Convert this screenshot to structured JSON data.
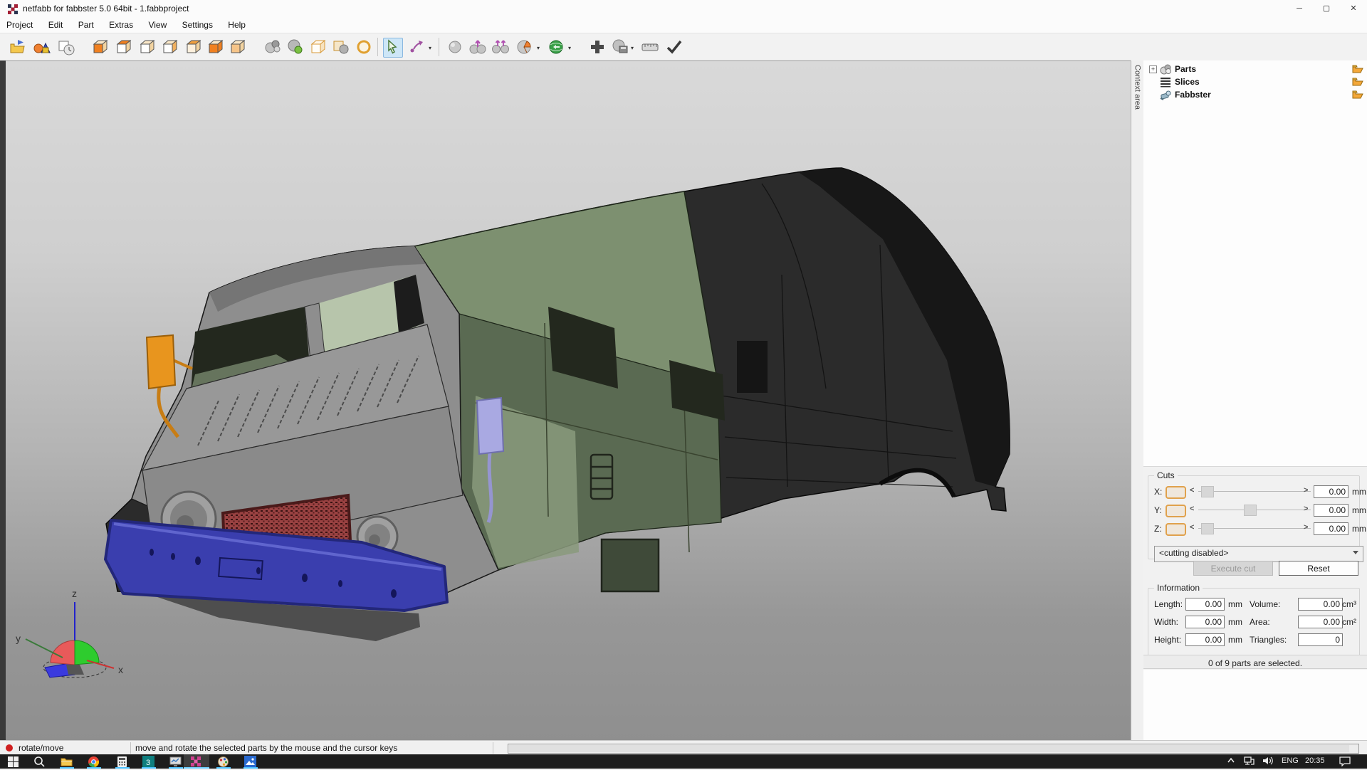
{
  "window": {
    "title": "netfabb for fabbster 5.0 64bit - 1.fabbproject",
    "controls": {
      "minimize": "─",
      "maximize": "▢",
      "close": "✕"
    }
  },
  "menu": {
    "items": [
      "Project",
      "Edit",
      "Part",
      "Extras",
      "View",
      "Settings",
      "Help"
    ]
  },
  "toolbar": {
    "icons": [
      "open-project-icon",
      "add-part-icon",
      "project-info-icon",
      "view-cube-front-icon",
      "view-cube-back-icon",
      "view-cube-left-icon",
      "view-cube-right-icon",
      "view-cube-top-icon",
      "view-cube-bottom-icon",
      "view-cube-iso-icon",
      "repair-part-icon",
      "part-quality-icon",
      "box-frame-icon",
      "cube-sphere-icon",
      "zoom-icon",
      "select-cursor-icon",
      "move-rotate-icon",
      "default-part-icon",
      "move-part-icon",
      "scale-part-icon",
      "analyse-icon",
      "slice-icon",
      "add-icon",
      "export-icon",
      "measure-icon",
      "validate-icon"
    ]
  },
  "viewport": {
    "context_tab": "Context area",
    "axis_labels": {
      "x": "x",
      "y": "y",
      "z": "z"
    }
  },
  "panel": {
    "tree": [
      {
        "label": "Parts"
      },
      {
        "label": "Slices"
      },
      {
        "label": "Fabbster"
      }
    ],
    "expander": "+",
    "cuts": {
      "title": "Cuts",
      "arrow_left": "<",
      "arrow_right": ">",
      "rows": [
        {
          "label": "X:",
          "value": "0.00",
          "unit": "mm"
        },
        {
          "label": "Y:",
          "value": "0.00",
          "unit": "mm"
        },
        {
          "label": "Z:",
          "value": "0.00",
          "unit": "mm"
        }
      ],
      "mode": "<cutting disabled>",
      "execute": "Execute cut",
      "reset": "Reset"
    },
    "info": {
      "title": "Information",
      "left": [
        {
          "label": "Length:",
          "value": "0.00",
          "unit": "mm"
        },
        {
          "label": "Width:",
          "value": "0.00",
          "unit": "mm"
        },
        {
          "label": "Height:",
          "value": "0.00",
          "unit": "mm"
        }
      ],
      "right": [
        {
          "label": "Volume:",
          "value": "0.00",
          "unit": "cm³"
        },
        {
          "label": "Area:",
          "value": "0.00",
          "unit": "cm²"
        },
        {
          "label": "Triangles:",
          "value": "0",
          "unit": ""
        }
      ]
    },
    "selection": "0 of 9 parts are selected."
  },
  "statusbar": {
    "mode": "rotate/move",
    "hint": "move and rotate the selected parts by the mouse and the cursor keys"
  },
  "taskbar": {
    "app3_label": "3",
    "tray": {
      "language": "ENG",
      "time": "20:35"
    }
  },
  "model": {
    "colors": {
      "body_dark": "#2b2b2b",
      "body_darkest": "#161616",
      "roof_green": "#7d9070",
      "side_green": "#5a6a52",
      "side_green_light": "#8a9a7c",
      "cab_gray": "#8e8e8e",
      "cab_roof_gray": "#757575",
      "hood_gray": "#989898",
      "front_gray": "#8a8a8a",
      "window_dark": "#23281e",
      "interior_green": "#b7c5ab",
      "grille_red": "#9a4242",
      "bumper_blue": "#3a3eae",
      "mirror_orange": "#e8951e",
      "mirror_purple": "#a9a9e2"
    }
  }
}
